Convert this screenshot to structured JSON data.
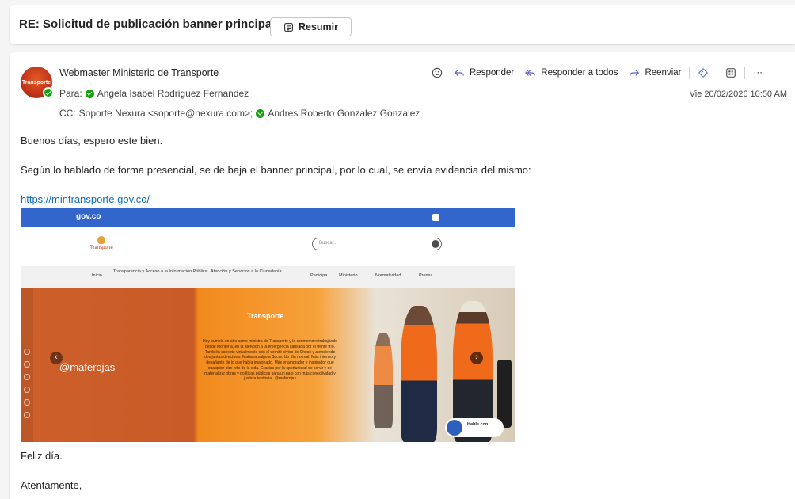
{
  "subject": {
    "title": "RE: Solicitud de publicación banner principal",
    "summarize_label": "Resumir"
  },
  "message": {
    "avatar_text": "Transporte",
    "sender": "Webmaster Ministerio de Transporte",
    "to_label": "Para:",
    "to": "Angela Isabel Rodriguez Fernandez",
    "cc_label": "CC:",
    "cc_1": "Soporte Nexura <soporte@nexura.com>;",
    "cc_2": "Andres Roberto Gonzalez Gonzalez",
    "datetime": "Vie 20/02/2026 10:50 AM",
    "actions": {
      "reply": "Responder",
      "reply_all": "Responder a todos",
      "forward": "Reenviar",
      "more": "···"
    }
  },
  "body": {
    "greeting": "Buenos días, espero este bien.",
    "paragraph": "Según lo hablado de forma presencial, se de baja el banner principal, por lo cual, se envía evidencia del mismo:",
    "link": "https://mintransporte.gov.co/",
    "closing_1": "Feliz día.",
    "closing_2": "Atentamente,"
  },
  "screenshot": {
    "gov_logo": "gov.co",
    "site_name": "Transporte",
    "search_placeholder": "Buscar...",
    "nav": [
      "Inicio",
      "Transparencia y Acceso a la Información Pública",
      "Atención y Servicios a la Ciudadanía",
      "Participa",
      "Ministerio",
      "Normatividad",
      "Prensa"
    ],
    "hero_handle": "@maferojas",
    "hero_brand": "Transporte",
    "hero_quote": "Hoy cumplo un año como ministra de Transporte y lo conmemoro trabajando desde Montería, en la atención a la emergencia causada por el frente frío. También conecté virtualmente con el comité cívico de Chocó y atendiendo dos juntas directivas. Mañana salgo a Sucre. Un día normal. Más intenso y desafiante de lo que había imaginado. Más enamorador e inspirador que cualquier otro reto de la vida. Gracias por la oportunidad de servir y de materializar obras y políticas públicas para un país con más conectividad y justicia territorial. @maferojas",
    "chat_label": "Hable con ..."
  }
}
